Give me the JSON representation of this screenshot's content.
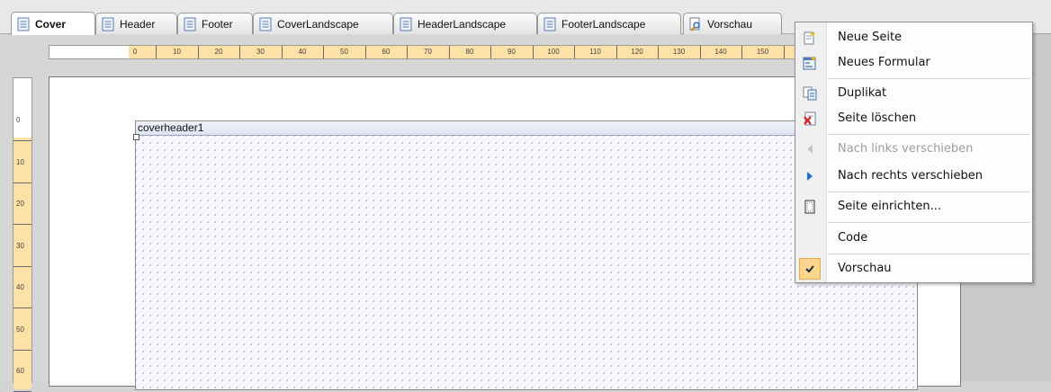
{
  "tabs": [
    {
      "label": "Cover",
      "active": true,
      "icon": "document-icon"
    },
    {
      "label": "Header",
      "active": false,
      "icon": "document-icon"
    },
    {
      "label": "Footer",
      "active": false,
      "icon": "document-icon"
    },
    {
      "label": "CoverLandscape",
      "active": false,
      "icon": "document-icon"
    },
    {
      "label": "HeaderLandscape",
      "active": false,
      "icon": "document-icon"
    },
    {
      "label": "FooterLandscape",
      "active": false,
      "icon": "document-icon"
    },
    {
      "label": "Vorschau",
      "active": false,
      "icon": "preview-magnifier-icon"
    }
  ],
  "ruler": {
    "horizontal_labels": [
      "0",
      "10",
      "20",
      "30",
      "40",
      "50",
      "60",
      "70",
      "80",
      "90",
      "100",
      "110",
      "120",
      "130",
      "140",
      "150"
    ],
    "vertical_labels": [
      "0",
      "10",
      "20",
      "30",
      "40",
      "50",
      "60"
    ]
  },
  "band": {
    "name": "coverheader1"
  },
  "menu": {
    "items": [
      {
        "label": "Neue Seite",
        "icon": "new-page-icon",
        "enabled": true
      },
      {
        "label": "Neues Formular",
        "icon": "new-form-icon",
        "enabled": true
      },
      {
        "label": "Duplikat",
        "icon": "duplicate-icon",
        "enabled": true
      },
      {
        "label": "Seite löschen",
        "icon": "delete-page-icon",
        "enabled": true
      },
      {
        "label": "Nach links verschieben",
        "icon": "arrow-left-icon",
        "enabled": false
      },
      {
        "label": "Nach rechts verschieben",
        "icon": "arrow-right-icon",
        "enabled": true
      },
      {
        "label": "Seite einrichten...",
        "icon": "page-setup-icon",
        "enabled": true
      },
      {
        "label": "Code",
        "icon": "",
        "enabled": true
      },
      {
        "label": "Vorschau",
        "icon": "checkmark-icon",
        "enabled": true,
        "checked": true
      }
    ]
  },
  "colors": {
    "ruler_highlight": "#fde1a6",
    "menu_check_bg": "#fcd58f",
    "arrow_blue": "#1d6fd8"
  }
}
